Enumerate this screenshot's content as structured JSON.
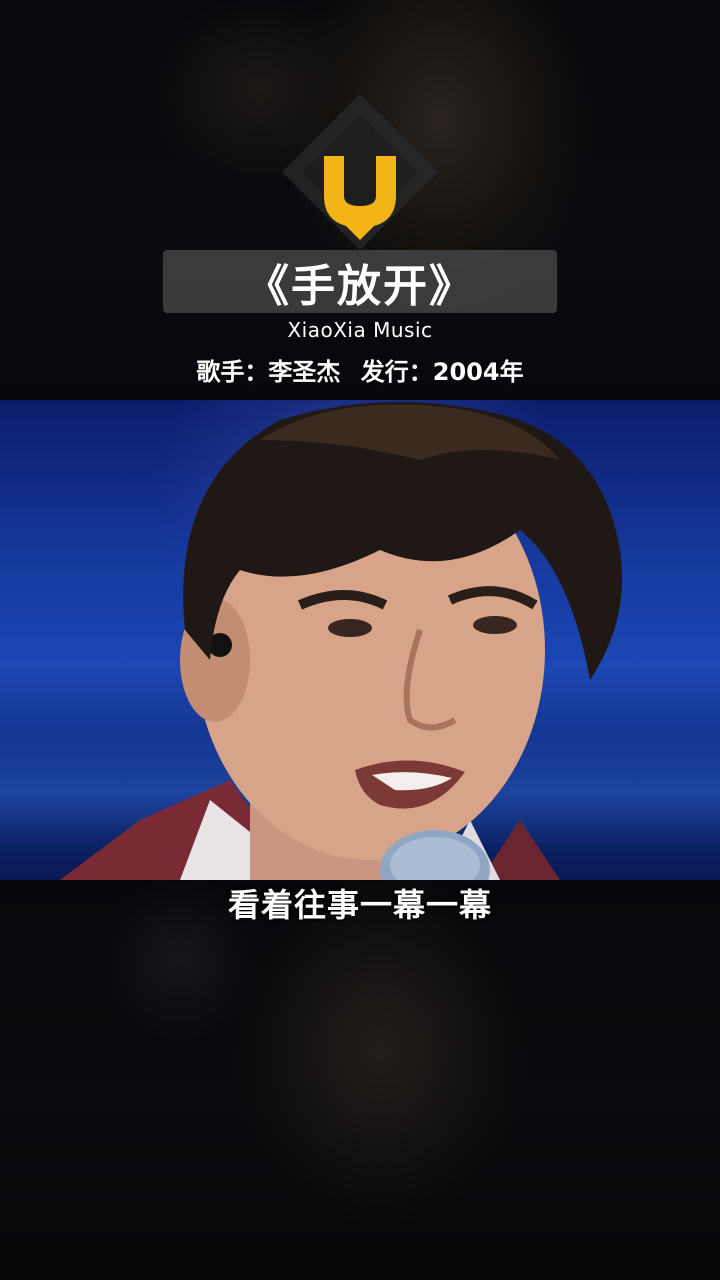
{
  "title": "《手放开》",
  "brand": "XiaoXia Music",
  "singer": "歌手：李圣杰",
  "release": "发行：2004年",
  "lyric": "看着往事一幕一幕",
  "colors": {
    "logo_yellow": "#f2b416",
    "title_bar_bg": "#464648",
    "stage_blue": "#1c47b4"
  },
  "icons": {
    "logo": "u-logo-icon"
  }
}
